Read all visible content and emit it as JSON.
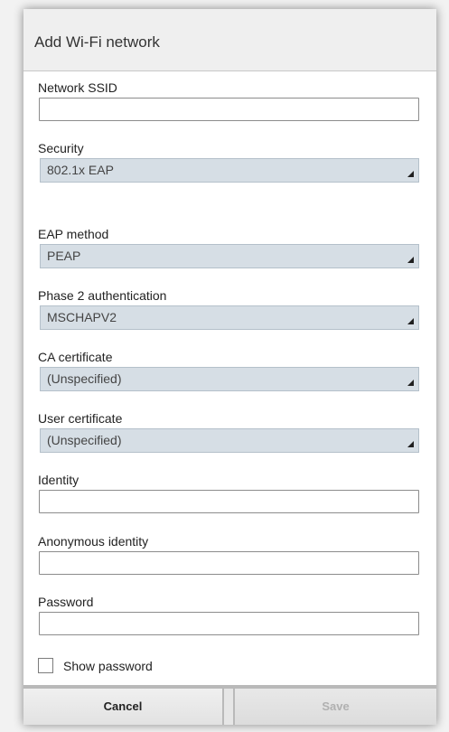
{
  "dialog": {
    "title": "Add Wi-Fi network"
  },
  "fields": {
    "ssid": {
      "label": "Network SSID",
      "value": ""
    },
    "security": {
      "label": "Security",
      "value": "802.1x EAP"
    },
    "eap_method": {
      "label": "EAP method",
      "value": "PEAP"
    },
    "phase2": {
      "label": "Phase 2 authentication",
      "value": "MSCHAPV2"
    },
    "ca_cert": {
      "label": "CA certificate",
      "value": "(Unspecified)"
    },
    "user_cert": {
      "label": "User certificate",
      "value": "(Unspecified)"
    },
    "identity": {
      "label": "Identity",
      "value": ""
    },
    "anonymous_identity": {
      "label": "Anonymous identity",
      "value": ""
    },
    "password": {
      "label": "Password",
      "value": ""
    }
  },
  "show_password": {
    "label": "Show password",
    "checked": false
  },
  "buttons": {
    "cancel": "Cancel",
    "save": "Save",
    "save_enabled": false
  },
  "icons": {
    "spinner_arrow": "triangle-corner-icon",
    "checkbox": "checkbox-icon"
  },
  "colors": {
    "spinner_bg": "#d6dee5",
    "title_bar_bg": "#efefef",
    "disabled_text": "#b0b0b0"
  }
}
